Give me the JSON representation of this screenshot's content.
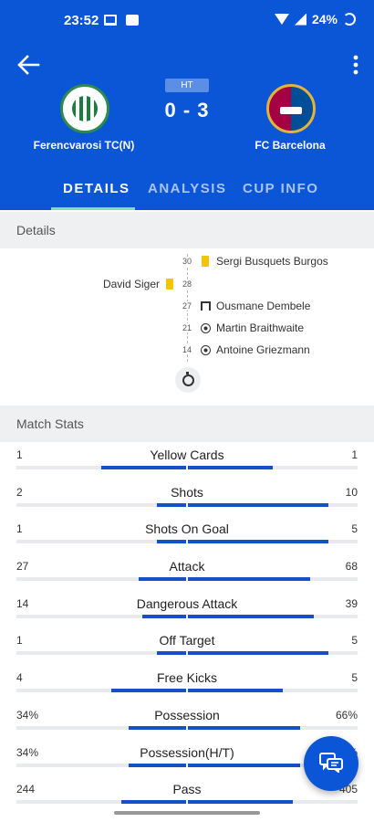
{
  "status_bar": {
    "time": "23:52",
    "battery": "24%"
  },
  "header": {
    "period_badge": "HT",
    "score": "0 - 3",
    "home_team": "Ferencvarosi TC(N)",
    "away_team": "FC Barcelona"
  },
  "tabs": [
    {
      "label": "DETAILS",
      "active": true
    },
    {
      "label": "ANALYSIS",
      "active": false
    },
    {
      "label": "CUP INFO",
      "active": false
    }
  ],
  "details": {
    "title": "Details",
    "events": [
      {
        "minute": "30",
        "side": "away",
        "type": "yellow-card",
        "player": "Sergi Busquets Burgos"
      },
      {
        "minute": "28",
        "side": "home",
        "type": "yellow-card",
        "player": "David Siger"
      },
      {
        "minute": "27",
        "side": "away",
        "type": "goal-post",
        "player": "Ousmane Dembele"
      },
      {
        "minute": "21",
        "side": "away",
        "type": "goal",
        "player": "Martin Braithwaite"
      },
      {
        "minute": "14",
        "side": "away",
        "type": "goal",
        "player": "Antoine Griezmann"
      }
    ]
  },
  "stats": {
    "title": "Match Stats",
    "rows": [
      {
        "label": "Yellow Cards",
        "home": "1",
        "away": "1",
        "home_frac": 0.5,
        "away_frac": 0.5
      },
      {
        "label": "Shots",
        "home": "2",
        "away": "10",
        "home_frac": 0.17,
        "away_frac": 0.83
      },
      {
        "label": "Shots On Goal",
        "home": "1",
        "away": "5",
        "home_frac": 0.17,
        "away_frac": 0.83
      },
      {
        "label": "Attack",
        "home": "27",
        "away": "68",
        "home_frac": 0.28,
        "away_frac": 0.72
      },
      {
        "label": "Dangerous Attack",
        "home": "14",
        "away": "39",
        "home_frac": 0.26,
        "away_frac": 0.74
      },
      {
        "label": "Off Target",
        "home": "1",
        "away": "5",
        "home_frac": 0.17,
        "away_frac": 0.83
      },
      {
        "label": "Free Kicks",
        "home": "4",
        "away": "5",
        "home_frac": 0.44,
        "away_frac": 0.56
      },
      {
        "label": "Possession",
        "home": "34%",
        "away": "66%",
        "home_frac": 0.34,
        "away_frac": 0.66
      },
      {
        "label": "Possession(H/T)",
        "home": "34%",
        "away": "66%",
        "home_frac": 0.34,
        "away_frac": 0.66
      },
      {
        "label": "Pass",
        "home": "244",
        "away": "405",
        "home_frac": 0.38,
        "away_frac": 0.62
      }
    ]
  },
  "colors": {
    "primary": "#0a56d6",
    "bar": "#1650c8",
    "yellow_card": "#f5c400",
    "tab_indicator": "#7fe0b5"
  },
  "icons": {
    "back": "arrow-left-icon",
    "menu": "more-vert-icon",
    "fab": "chat-icon",
    "timeline": "stopwatch-icon"
  }
}
